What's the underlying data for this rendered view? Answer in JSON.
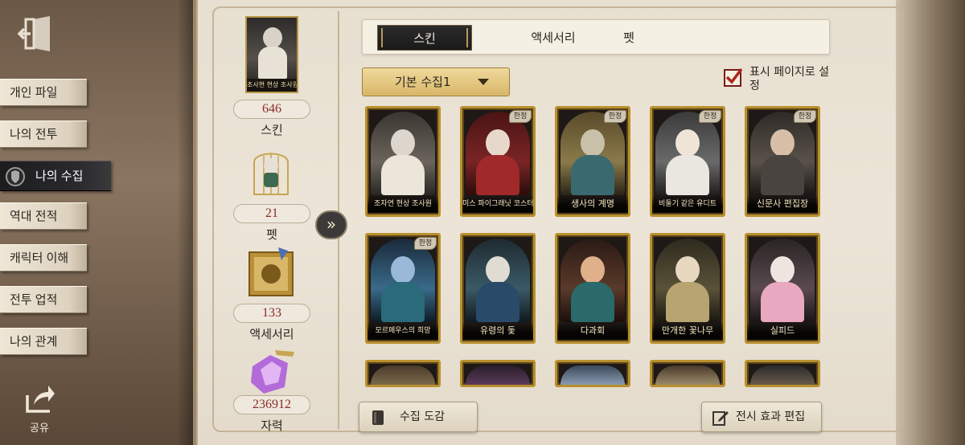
{
  "nav": {
    "items": [
      {
        "label": "개인 파일",
        "active": false
      },
      {
        "label": "나의 전투",
        "active": false
      },
      {
        "label": "나의 수집",
        "active": true
      },
      {
        "label": "역대 전적",
        "active": false
      },
      {
        "label": "캐릭터 이해",
        "active": false
      },
      {
        "label": "전투 업적",
        "active": false
      },
      {
        "label": "나의 관계",
        "active": false
      }
    ],
    "share_label": "공유"
  },
  "summary": {
    "portrait_caption": "조사현 현상 조사원",
    "skin_count": "646",
    "skin_label": "스킨",
    "pet_count": "21",
    "pet_label": "펫",
    "accessory_count": "133",
    "accessory_label": "액세서리",
    "material_count": "236912",
    "material_label": "자력"
  },
  "tabs": [
    {
      "label": "스킨",
      "active": true
    },
    {
      "label": "액세서리",
      "active": false
    },
    {
      "label": "펫",
      "active": false
    }
  ],
  "filter": {
    "selected": "기본 수집1",
    "display_label": "표시 페이지로 설정",
    "display_checked": true
  },
  "cards": [
    {
      "name": "조자연 현상 조사원",
      "limited": false
    },
    {
      "name": "미스 파이그래닛 코스터",
      "limited": true
    },
    {
      "name": "생사의 계명",
      "limited": true
    },
    {
      "name": "비둘기 같은 유디트",
      "limited": true
    },
    {
      "name": "신문사 편집장",
      "limited": true
    },
    {
      "name": "모르페우스의 희망",
      "limited": true
    },
    {
      "name": "유령의 돛",
      "limited": false
    },
    {
      "name": "다과회",
      "limited": false
    },
    {
      "name": "만개한 꽃나무",
      "limited": false
    },
    {
      "name": "실피드",
      "limited": false
    }
  ],
  "limited_badge": "한정",
  "buttons": {
    "collection_guide": "수집 도감",
    "display_effect_edit": "전시 효과 편집"
  },
  "colors": {
    "accent_gold": "#b8902e",
    "count_red": "#8a2a28",
    "panel_bg": "#ece5d7"
  }
}
